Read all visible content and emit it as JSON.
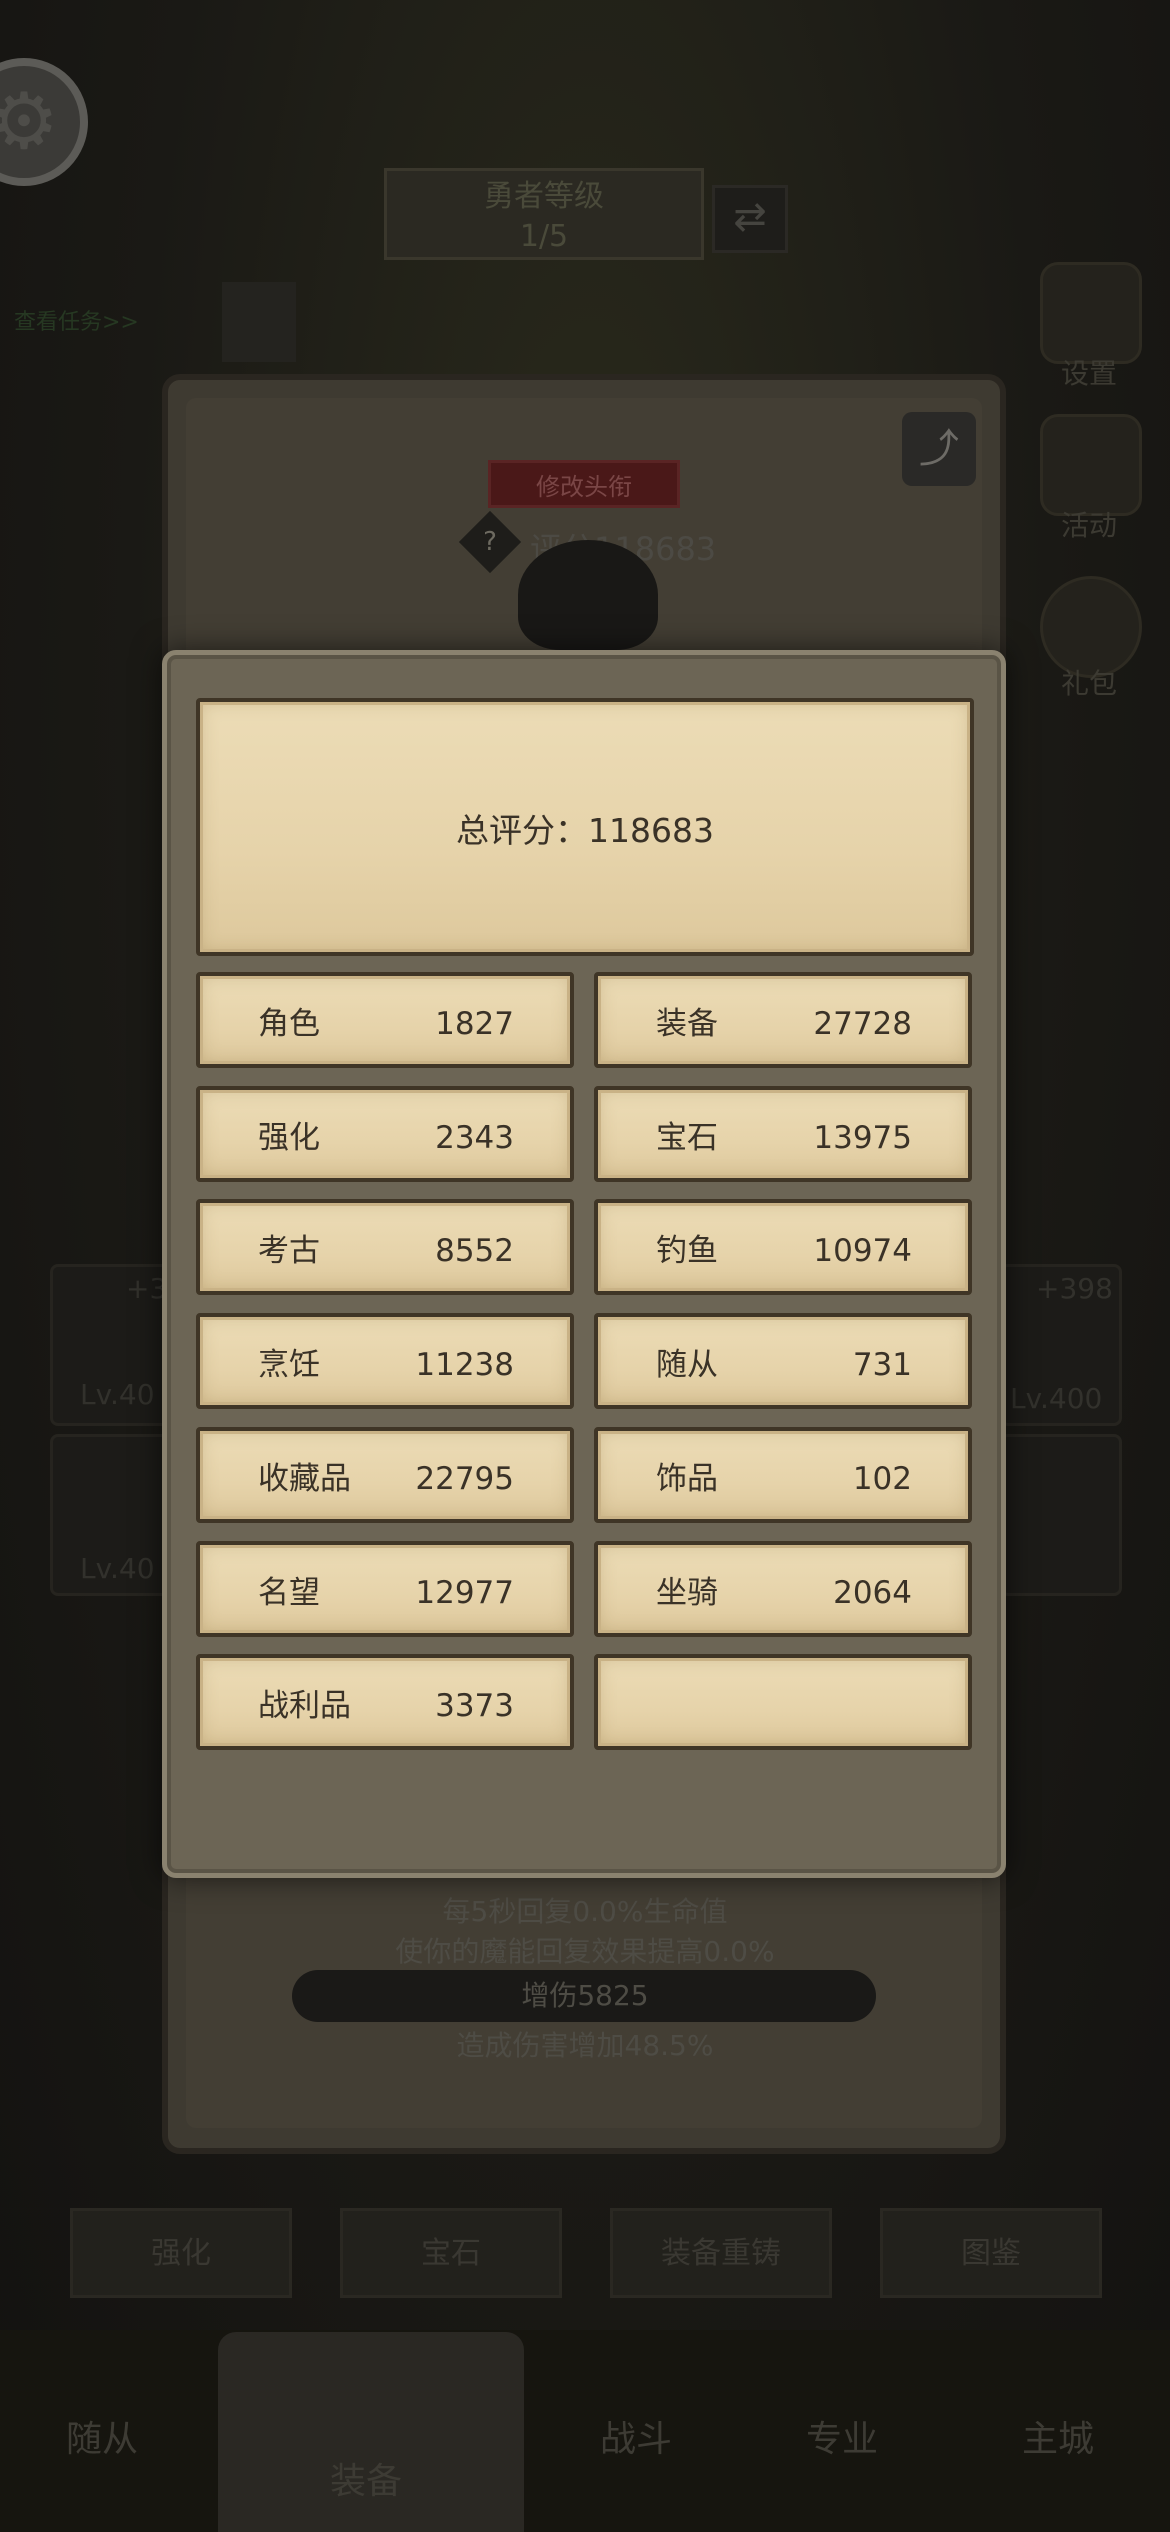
{
  "background": {
    "title_line1": "勇者等级",
    "title_line2": "1/5",
    "quest_link": "查看任务>>",
    "back_panel": {
      "edit_title_label": "修改头衔",
      "score_label": "评分118683"
    },
    "sidebar": [
      "设置",
      "活动",
      "礼包"
    ],
    "stats": [
      "每5秒回复0.0%生命值",
      "使你的魔能回复效果提高0.0%",
      "增伤5825",
      "造成伤害增加48.5%"
    ],
    "slots": {
      "left_top_bonus": "+3",
      "left_top_level": "Lv.40",
      "left_bottom_level": "Lv.40",
      "right_top_bonus": "+398",
      "right_top_level": "Lv.400"
    },
    "action_buttons": [
      "强化",
      "宝石",
      "装备重铸",
      "图鉴"
    ],
    "nav": [
      "随从",
      "装备",
      "战斗",
      "专业",
      "主城"
    ]
  },
  "modal": {
    "total_label": "总评分：118683",
    "rows": [
      [
        {
          "label": "角色",
          "value": "1827"
        },
        {
          "label": "装备",
          "value": "27728"
        }
      ],
      [
        {
          "label": "强化",
          "value": "2343"
        },
        {
          "label": "宝石",
          "value": "13975"
        }
      ],
      [
        {
          "label": "考古",
          "value": "8552"
        },
        {
          "label": "钓鱼",
          "value": "10974"
        }
      ],
      [
        {
          "label": "烹饪",
          "value": "11238"
        },
        {
          "label": "随从",
          "value": "731"
        }
      ],
      [
        {
          "label": "收藏品",
          "value": "22795"
        },
        {
          "label": "饰品",
          "value": "102"
        }
      ],
      [
        {
          "label": "名望",
          "value": "12977"
        },
        {
          "label": "坐骑",
          "value": "2064"
        }
      ],
      [
        {
          "label": "战利品",
          "value": "3373"
        },
        {
          "label": "",
          "value": ""
        }
      ]
    ]
  }
}
